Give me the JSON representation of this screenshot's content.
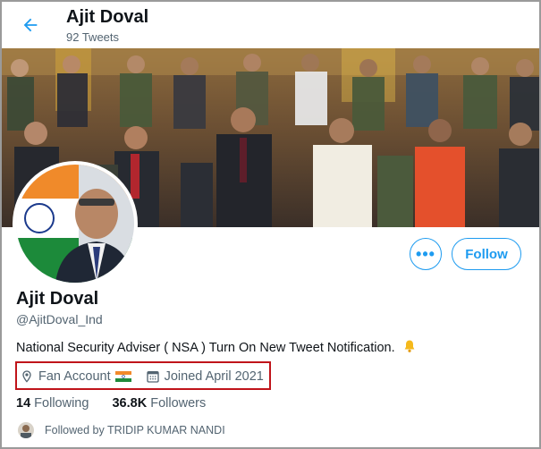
{
  "header": {
    "title": "Ajit Doval",
    "tweet_count": "92 Tweets"
  },
  "profile": {
    "display_name": "Ajit Doval",
    "handle": "@AjitDoval_Ind",
    "bio": "National Security Adviser ( NSA ) Turn On New Tweet Notification.",
    "location": "Fan Account",
    "joined": "Joined April 2021"
  },
  "stats": {
    "following_count": "14",
    "following_label": "Following",
    "followers_count": "36.8K",
    "followers_label": "Followers"
  },
  "followed_by": "Followed by TRIDIP KUMAR NANDI",
  "actions": {
    "more_label": "•••",
    "follow_label": "Follow"
  },
  "colors": {
    "accent": "#1d9bf0",
    "highlight_box": "#c0141a",
    "muted": "#536471"
  },
  "icons": [
    "back-arrow-icon",
    "location-pin-icon",
    "india-flag-icon",
    "calendar-icon",
    "bell-icon"
  ]
}
